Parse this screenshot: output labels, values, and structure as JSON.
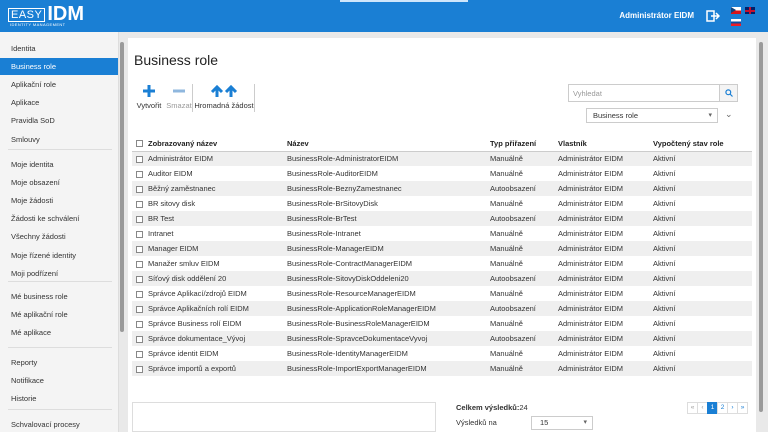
{
  "header": {
    "logo_easy": "EASY",
    "logo_idm": "IDM",
    "logo_sub": "IDENTITY MANAGEMENT",
    "user": "Administrátor EIDM"
  },
  "sidebar": {
    "groups": [
      [
        {
          "label": "Identita",
          "active": false
        },
        {
          "label": "Business role",
          "active": true
        },
        {
          "label": "Aplikační role",
          "active": false
        },
        {
          "label": "Aplikace",
          "active": false
        },
        {
          "label": "Pravidla SoD",
          "active": false
        },
        {
          "label": "Smlouvy",
          "active": false
        }
      ],
      [
        {
          "label": "Moje identita",
          "active": false
        },
        {
          "label": "Moje obsazení",
          "active": false
        },
        {
          "label": "Moje žádosti",
          "active": false
        },
        {
          "label": "Žádosti ke schválení",
          "active": false
        },
        {
          "label": "Všechny žádosti",
          "active": false
        },
        {
          "label": "Moje řízené identity",
          "active": false
        },
        {
          "label": "Moji podřízení",
          "active": false
        }
      ],
      [
        {
          "label": "Mé business role",
          "active": false
        },
        {
          "label": "Mé aplikační role",
          "active": false
        },
        {
          "label": "Mé aplikace",
          "active": false
        }
      ],
      [
        {
          "label": "Reporty",
          "active": false
        },
        {
          "label": "Notifikace",
          "active": false
        },
        {
          "label": "Historie",
          "active": false
        }
      ],
      [
        {
          "label": "Schvalovací procesy",
          "active": false
        }
      ]
    ]
  },
  "page": {
    "title": "Business role"
  },
  "toolbar": {
    "create": "Vytvořit",
    "delete": "Smazat",
    "bulk": "Hromadná žádost"
  },
  "search": {
    "placeholder": "Vyhledat"
  },
  "filter": {
    "selected": "Business role"
  },
  "table": {
    "columns": [
      "Zobrazovaný název",
      "Název",
      "Typ přiřazení",
      "Vlastník",
      "Vypočtený stav role"
    ],
    "rows": [
      [
        "Administrátor EIDM",
        "BusinessRole-AdministratorEIDM",
        "Manuálně",
        "Administrátor EIDM",
        "Aktivní"
      ],
      [
        "Auditor EIDM",
        "BusinessRole-AuditorEIDM",
        "Manuálně",
        "Administrátor EIDM",
        "Aktivní"
      ],
      [
        "Běžný zaměstnanec",
        "BusinessRole-BeznyZamestnanec",
        "Autoobsazení",
        "Administrátor EIDM",
        "Aktivní"
      ],
      [
        "BR sitovy disk",
        "BusinessRole-BrSitovyDisk",
        "Manuálně",
        "Administrátor EIDM",
        "Aktivní"
      ],
      [
        "BR Test",
        "BusinessRole-BrTest",
        "Autoobsazení",
        "Administrátor EIDM",
        "Aktivní"
      ],
      [
        "Intranet",
        "BusinessRole-Intranet",
        "Manuálně",
        "Administrátor EIDM",
        "Aktivní"
      ],
      [
        "Manager EIDM",
        "BusinessRole-ManagerEIDM",
        "Manuálně",
        "Administrátor EIDM",
        "Aktivní"
      ],
      [
        "Manažer smluv EIDM",
        "BusinessRole-ContractManagerEIDM",
        "Manuálně",
        "Administrátor EIDM",
        "Aktivní"
      ],
      [
        "Síťový disk oddělení 20",
        "BusinessRole-SitovyDiskOddeleni20",
        "Autoobsazení",
        "Administrátor EIDM",
        "Aktivní"
      ],
      [
        "Správce Aplikací/zdrojů EIDM",
        "BusinessRole-ResourceManagerEIDM",
        "Manuálně",
        "Administrátor EIDM",
        "Aktivní"
      ],
      [
        "Správce Aplikačních rolí EIDM",
        "BusinessRole-ApplicationRoleManagerEIDM",
        "Autoobsazení",
        "Administrátor EIDM",
        "Aktivní"
      ],
      [
        "Správce Business rolí EIDM",
        "BusinessRole-BusinessRoleManagerEIDM",
        "Manuálně",
        "Administrátor EIDM",
        "Aktivní"
      ],
      [
        "Správce dokumentace_Vývoj",
        "BusinessRole-SpravceDokumentaceVyvoj",
        "Autoobsazení",
        "Administrátor EIDM",
        "Aktivní"
      ],
      [
        "Správce identit EIDM",
        "BusinessRole-IdentityManagerEIDM",
        "Manuálně",
        "Administrátor EIDM",
        "Aktivní"
      ],
      [
        "Správce importů a exportů",
        "BusinessRole-ImportExportManagerEIDM",
        "Manuálně",
        "Administrátor EIDM",
        "Aktivní"
      ]
    ]
  },
  "footer": {
    "total_label": "Celkem výsledků:",
    "total_value": "24",
    "per_page_label": "Výsledků na",
    "per_page_value": "15"
  },
  "pager": [
    "«",
    "‹",
    "1",
    "2",
    "›",
    "»"
  ],
  "colors": {
    "brand": "#1a7fd4"
  }
}
